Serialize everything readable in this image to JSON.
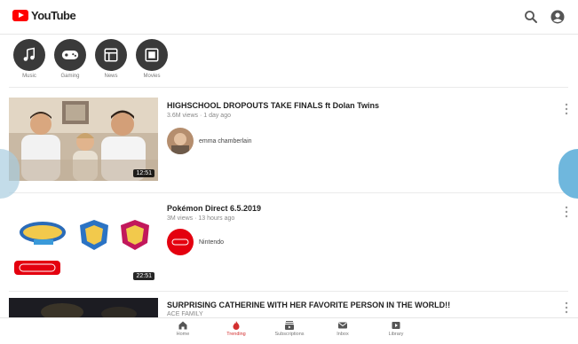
{
  "header": {
    "logo_text": "YouTube"
  },
  "categories": [
    {
      "label": "Music",
      "icon": "music-note-icon"
    },
    {
      "label": "Gaming",
      "icon": "gaming-controller-icon"
    },
    {
      "label": "News",
      "icon": "news-icon"
    },
    {
      "label": "Movies",
      "icon": "movies-icon"
    }
  ],
  "videos": [
    {
      "title": "HIGHSCHOOL DROPOUTS TAKE FINALS ft Dolan Twins",
      "meta": "3.6M views · 1 day ago",
      "channel": "emma chamberlain",
      "duration": "12:51"
    },
    {
      "title": "Pokémon Direct 6.5.2019",
      "meta": "3M views · 13 hours ago",
      "channel": "Nintendo",
      "duration": "22:51"
    },
    {
      "title": "SURPRISING CATHERINE WITH HER FAVORITE PERSON IN THE WORLD!!",
      "meta": "ACE FAMILY"
    }
  ],
  "bottom_nav": [
    {
      "label": "Home",
      "icon": "home-icon",
      "active": false
    },
    {
      "label": "Trending",
      "icon": "trending-flame-icon",
      "active": true
    },
    {
      "label": "Subscriptions",
      "icon": "subscriptions-icon",
      "active": false
    },
    {
      "label": "Inbox",
      "icon": "inbox-icon",
      "active": false
    },
    {
      "label": "Library",
      "icon": "library-icon",
      "active": false
    }
  ],
  "colors": {
    "brand_red": "#ff0000",
    "active_nav": "#d32f2f",
    "category_bg": "#3a3a3a",
    "side_tab": "#6fb7dd"
  }
}
